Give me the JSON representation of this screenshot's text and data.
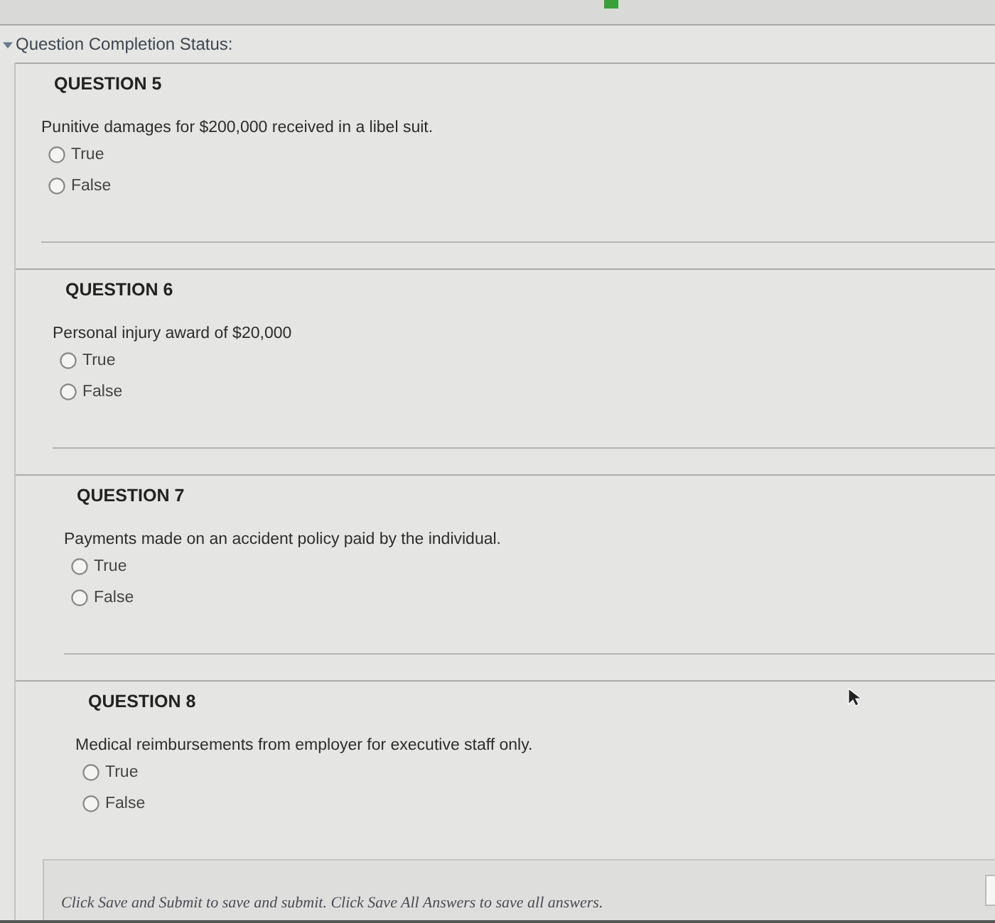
{
  "status_header": {
    "label": "Question Completion Status:",
    "expanded": true
  },
  "questions": [
    {
      "title": "QUESTION 5",
      "prompt": "Punitive damages for $200,000 received in a libel suit.",
      "options": [
        {
          "label": "True",
          "selected": false
        },
        {
          "label": "False",
          "selected": false
        }
      ]
    },
    {
      "title": "QUESTION 6",
      "prompt": "Personal injury award of $20,000",
      "options": [
        {
          "label": "True",
          "selected": false
        },
        {
          "label": "False",
          "selected": false
        }
      ]
    },
    {
      "title": "QUESTION 7",
      "prompt": "Payments made on an accident policy paid by the individual.",
      "options": [
        {
          "label": "True",
          "selected": false
        },
        {
          "label": "False",
          "selected": false
        }
      ]
    },
    {
      "title": "QUESTION 8",
      "prompt": "Medical reimbursements from employer for executive staff only.",
      "options": [
        {
          "label": "True",
          "selected": false
        },
        {
          "label": "False",
          "selected": false
        }
      ]
    }
  ],
  "footer": {
    "instructions": "Click Save and Submit to save and submit. Click Save All Answers to save all answers."
  }
}
